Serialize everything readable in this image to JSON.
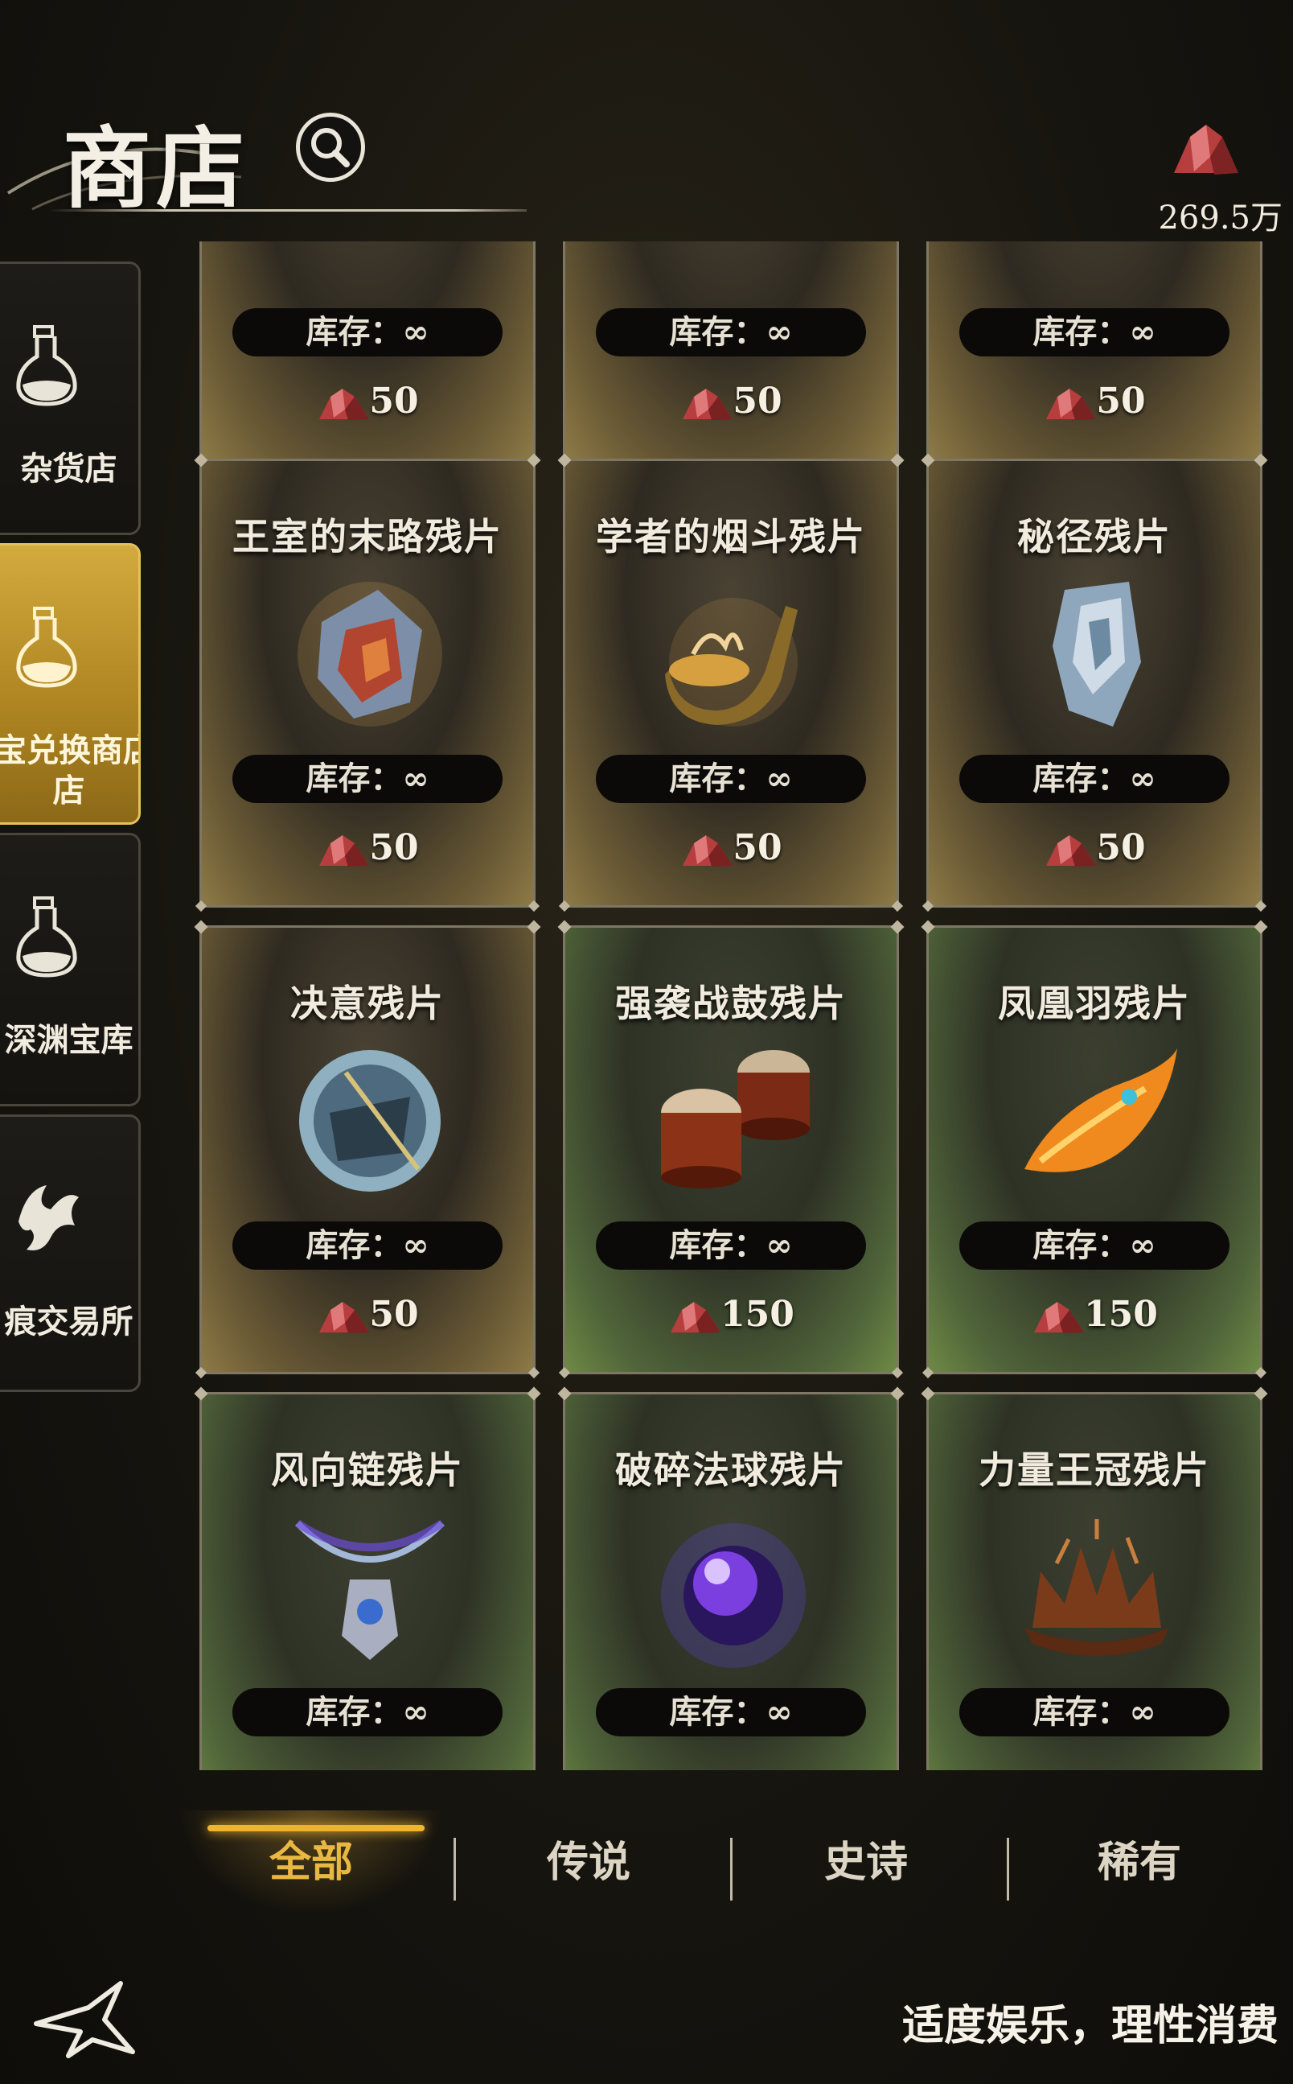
{
  "header": {
    "title": "商店",
    "currency_amount": "269.5万"
  },
  "sidebar": {
    "items": [
      {
        "label": "杂货店",
        "active": false,
        "icon": "potion-flask-icon"
      },
      {
        "label": "宝兑换商店",
        "label2": "店",
        "active": true,
        "icon": "potion-flask-icon"
      },
      {
        "label": "深渊宝库",
        "active": false,
        "icon": "potion-flask-icon"
      },
      {
        "label": "痕交易所",
        "active": false,
        "icon": "dragon-emblem-icon"
      }
    ]
  },
  "shop": {
    "stock_label": "库存：∞",
    "cards": [
      {
        "name": "",
        "price": "50",
        "style": "gold",
        "art": "partial-top-item"
      },
      {
        "name": "",
        "price": "50",
        "style": "gold",
        "art": "partial-top-item"
      },
      {
        "name": "",
        "price": "50",
        "style": "gold",
        "art": "partial-top-item"
      },
      {
        "name": "王室的末路残片",
        "price": "50",
        "style": "gold",
        "art": "royal-shard-icon"
      },
      {
        "name": "学者的烟斗残片",
        "price": "50",
        "style": "gold",
        "art": "pipe-icon"
      },
      {
        "name": "秘径残片",
        "price": "50",
        "style": "gold",
        "art": "crystal-shard-icon"
      },
      {
        "name": "决意残片",
        "price": "50",
        "style": "gold",
        "art": "resolve-shard-icon"
      },
      {
        "name": "强袭战鼓残片",
        "price": "150",
        "style": "green",
        "art": "war-drum-icon"
      },
      {
        "name": "凤凰羽残片",
        "price": "150",
        "style": "green",
        "art": "phoenix-feather-icon"
      },
      {
        "name": "风向链残片",
        "price": "",
        "style": "green",
        "art": "amulet-icon"
      },
      {
        "name": "破碎法球残片",
        "price": "",
        "style": "green",
        "art": "orb-icon"
      },
      {
        "name": "力量王冠残片",
        "price": "",
        "style": "green",
        "art": "crown-icon"
      }
    ]
  },
  "tabs": [
    {
      "label": "全部",
      "active": true
    },
    {
      "label": "传说",
      "active": false
    },
    {
      "label": "史诗",
      "active": false
    },
    {
      "label": "稀有",
      "active": false
    }
  ],
  "footer": {
    "notice": "适度娱乐，理性消费",
    "logo": "game-logo-icon"
  },
  "colors": {
    "accent_gold": "#f0b62d",
    "card_gold": "#8d7a46",
    "card_green": "#6e8a45",
    "gem_red": "#b03a3a"
  }
}
